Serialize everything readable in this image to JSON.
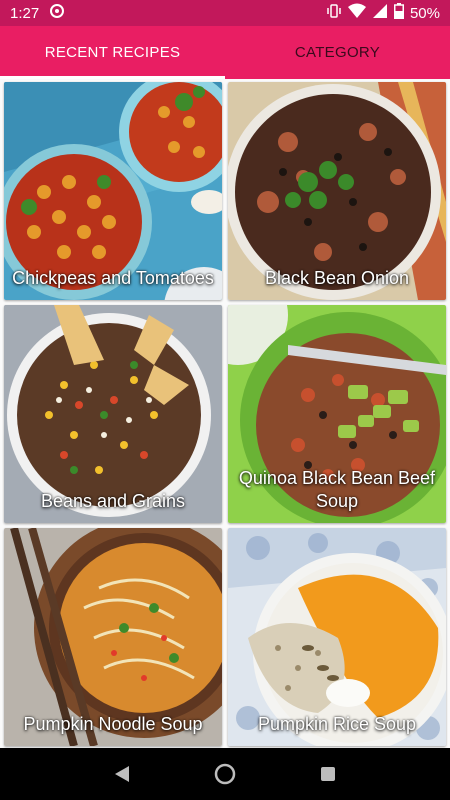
{
  "status": {
    "time": "1:27",
    "battery": "50%"
  },
  "tabs": [
    {
      "label": "RECENT RECIPES",
      "selected": true
    },
    {
      "label": "CATEGORY",
      "selected": false
    }
  ],
  "recipes": [
    {
      "title": "Chickpeas and Tomatoes"
    },
    {
      "title": "Black Bean Onion"
    },
    {
      "title": "Beans and Grains"
    },
    {
      "title": "Quinoa Black Bean Beef Soup"
    },
    {
      "title": "Pumpkin Noodle Soup"
    },
    {
      "title": "Pumpkin Rice Soup"
    }
  ],
  "colors": {
    "status_bar": "#c2185b",
    "app_bar": "#e91e63",
    "indicator": "#ffffff"
  }
}
